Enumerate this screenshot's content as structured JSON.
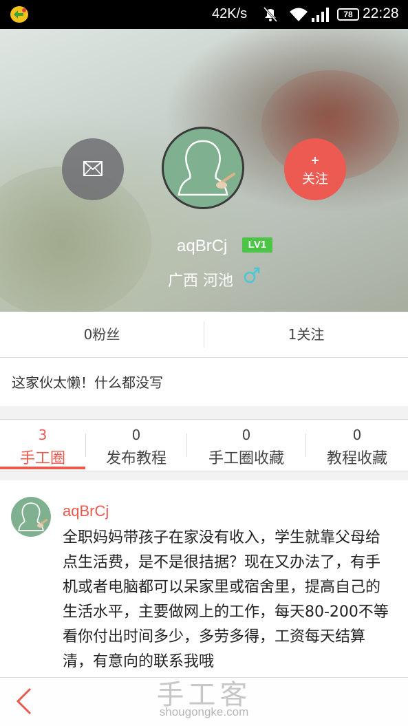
{
  "status_bar": {
    "speed": "42K/s",
    "battery": "78",
    "time": "22:28"
  },
  "profile": {
    "username": "aqBrCj",
    "level": "LV1",
    "location": "广西  河池",
    "follow_plus": "+",
    "follow_label": "关注"
  },
  "stats": {
    "fans": "0粉丝",
    "following": "1关注"
  },
  "bio": "这家伙太懒！什么都没写",
  "tabs": [
    {
      "count": "3",
      "label": "手工圈"
    },
    {
      "count": "0",
      "label": "发布教程"
    },
    {
      "count": "0",
      "label": "手工圈收藏"
    },
    {
      "count": "0",
      "label": "教程收藏"
    }
  ],
  "post": {
    "author": "aqBrCj",
    "text": "全职妈妈带孩子在家没有收入，学生就靠父母给点生活费，是不是很拮据？现在又办法了，有手机或者电脑都可以呆家里或宿舍里，提高自己的生活水平，主要做网上的工作，每天80-200不等看你付出时间多少，多劳多得，工资每天结算清，有意向的联系我哦"
  },
  "watermark": {
    "cn": "手工客",
    "en": "shougongke.com"
  },
  "colors": {
    "accent": "#e85a4f",
    "follow_button": "#ec5a52",
    "level_badge": "#4cc445",
    "avatar_bg": "#7fb08f"
  }
}
